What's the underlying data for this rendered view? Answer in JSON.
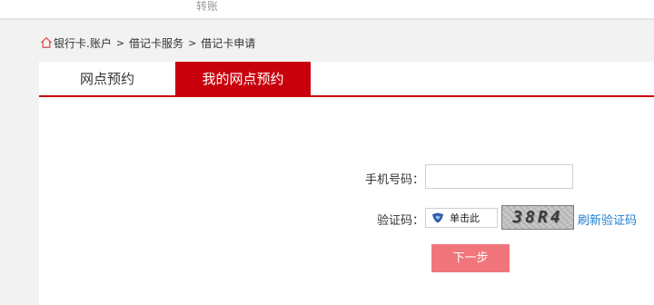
{
  "topbar": {
    "item": "转账"
  },
  "breadcrumb": {
    "home_icon": "home-icon",
    "items": [
      "银行卡.账户",
      "借记卡服务",
      "借记卡申请"
    ],
    "separator": ">"
  },
  "tabs": [
    {
      "label": "网点预约",
      "active": false
    },
    {
      "label": "我的网点预约",
      "active": true
    }
  ],
  "form": {
    "phone_label": "手机号码：",
    "phone_value": "",
    "captcha_label": "验证码：",
    "captcha_input_text": "单击此",
    "captcha_shield_icon": "shield-icon",
    "captcha_image_text": "38R4",
    "refresh_label": "刷新验证码",
    "next_label": "下一步"
  },
  "colors": {
    "accent_red": "#c8000c",
    "next_button": "#f1767b",
    "link_blue": "#1d7fd1"
  }
}
